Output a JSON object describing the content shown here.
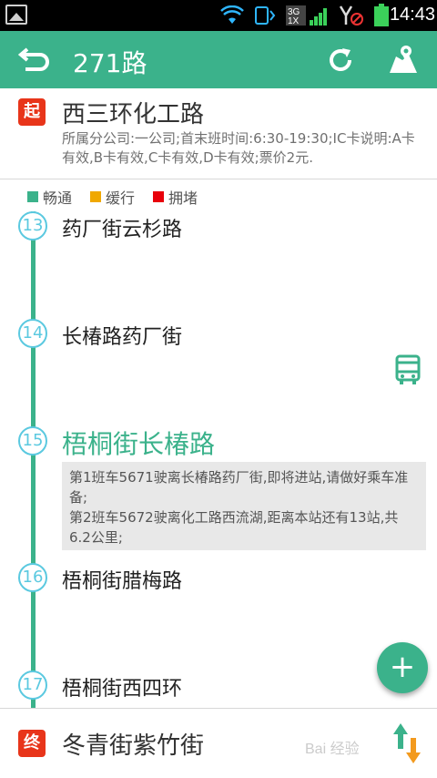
{
  "status_bar": {
    "time": "14:43",
    "network_label_top": "3G",
    "network_label_bottom": "1X"
  },
  "app_bar": {
    "title": "271路"
  },
  "start_stop": {
    "badge": "起",
    "name": "西三环化工路",
    "info": "所属分公司:一公司;首末班时间:6:30-19:30;IC卡说明:A卡有效,B卡有效,C卡有效,D卡有效;票价2元."
  },
  "legend": [
    {
      "label": "畅通",
      "color": "#3bb28b"
    },
    {
      "label": "缓行",
      "color": "#f0a800"
    },
    {
      "label": "拥堵",
      "color": "#e8000b"
    }
  ],
  "stops": [
    {
      "number": "13",
      "name": "药厂街云杉路"
    },
    {
      "number": "14",
      "name": "长椿路药厂街"
    },
    {
      "number": "15",
      "name": "梧桐街长椿路"
    },
    {
      "number": "16",
      "name": "梧桐街腊梅路"
    },
    {
      "number": "17",
      "name": "梧桐街西四环"
    }
  ],
  "arrival_info": {
    "line1": "第1班车5671驶离长椿路药厂街,即将进站,请做好乘车准备;",
    "line2": "第2班车5672驶离化工路西流湖,距离本站还有13站,共6.2公里;"
  },
  "fab_label": "+",
  "end_stop": {
    "badge": "终",
    "name": "冬青街紫竹街"
  },
  "watermark": "Bai 经验",
  "icons": {
    "back": "back-arrow-icon",
    "refresh": "refresh-icon",
    "map": "map-icon",
    "bus": "bus-icon",
    "swap": "swap-direction-icon"
  }
}
